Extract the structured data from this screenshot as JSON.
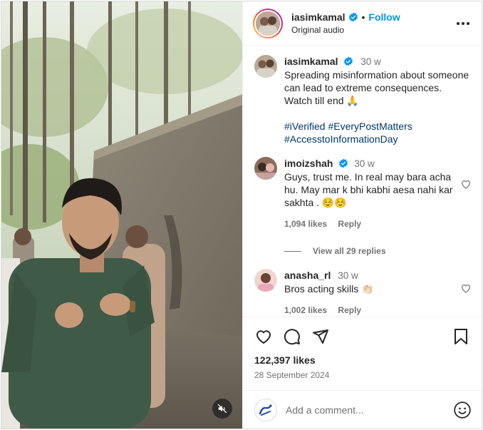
{
  "post": {
    "author": "iasimkamal",
    "follow_label": "Follow",
    "separator": "•",
    "audio": "Original audio",
    "more_label": "•••"
  },
  "caption": {
    "author": "iasimkamal",
    "time": "30 w",
    "text": "Spreading misinformation about someone can lead to extreme consequences. Watch till end 🙏",
    "hashtags": "#iVerified #EveryPostMatters #AccesstoInformationDay"
  },
  "comments": [
    {
      "author": "imoizshah",
      "time": "30 w",
      "text": "Guys, trust me. In real may bara acha hu. May mar k bhi kabhi aesa nahi kar sakhta . ☺️☺️",
      "likes": "1,094 likes",
      "reply_label": "Reply"
    },
    {
      "author": "anasha_rl",
      "time": "30 w",
      "text": "Bros acting skills 👏🏻",
      "likes": "1,002 likes",
      "reply_label": "Reply"
    }
  ],
  "view_replies": "View all 29 replies",
  "stats": {
    "likes": "122,397 likes",
    "date": "28 September 2024"
  },
  "composer": {
    "placeholder": "Add a comment..."
  },
  "colors": {
    "accent": "#0095f6",
    "hashtag": "#00376b",
    "verified": "#0095f6",
    "muted": "#737373"
  },
  "icons": {
    "like": "heart-icon",
    "comment": "comment-icon",
    "share": "paper-plane-icon",
    "save": "bookmark-icon",
    "mute": "speaker-muted-icon",
    "more": "more-options-icon",
    "emoji": "emoji-icon"
  }
}
